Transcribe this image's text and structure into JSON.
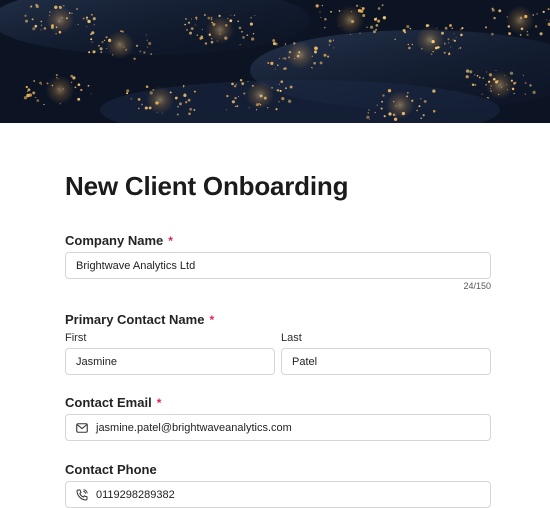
{
  "header": {
    "image": "night-earth-city-lights"
  },
  "form": {
    "title": "New Client Onboarding",
    "required_marker": "*",
    "company_name": {
      "label": "Company Name",
      "value": "Brightwave Analytics Ltd",
      "counter": "24/150"
    },
    "primary_contact": {
      "label": "Primary Contact Name",
      "first_label": "First",
      "first_value": "Jasmine",
      "last_label": "Last",
      "last_value": "Patel"
    },
    "contact_email": {
      "label": "Contact Email",
      "value": "jasmine.patel@brightwaveanalytics.com",
      "icon": "mail-icon"
    },
    "contact_phone": {
      "label": "Contact Phone",
      "value": "0119298289382",
      "icon": "phone-icon"
    }
  },
  "colors": {
    "required": "#e0245e",
    "border": "#d6d6d6"
  }
}
